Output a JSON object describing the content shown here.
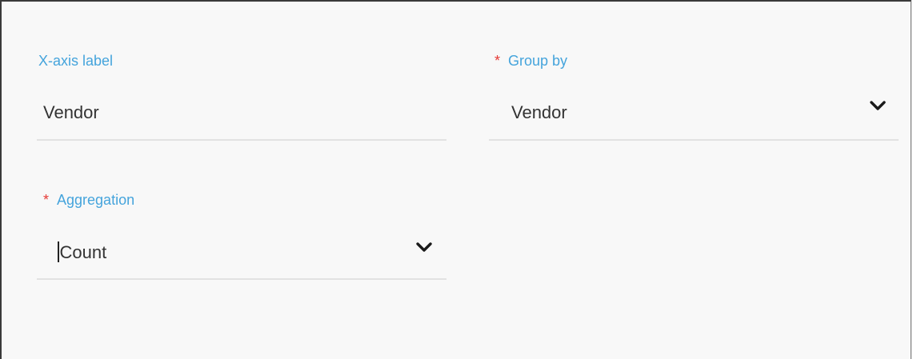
{
  "form": {
    "xaxis_label": {
      "label": "X-axis label",
      "value": "Vendor"
    },
    "group_by": {
      "required_mark": "*",
      "label": "Group by",
      "value": "Vendor",
      "icon": "chevron-down-icon"
    },
    "aggregation": {
      "required_mark": "*",
      "label": "Aggregation",
      "value": "Count",
      "icon": "chevron-down-icon"
    }
  },
  "colors": {
    "label": "#45a4dc",
    "required": "#e53935",
    "value_text": "#333333",
    "underline": "#e2e2e2",
    "background": "#f8f8f8"
  }
}
